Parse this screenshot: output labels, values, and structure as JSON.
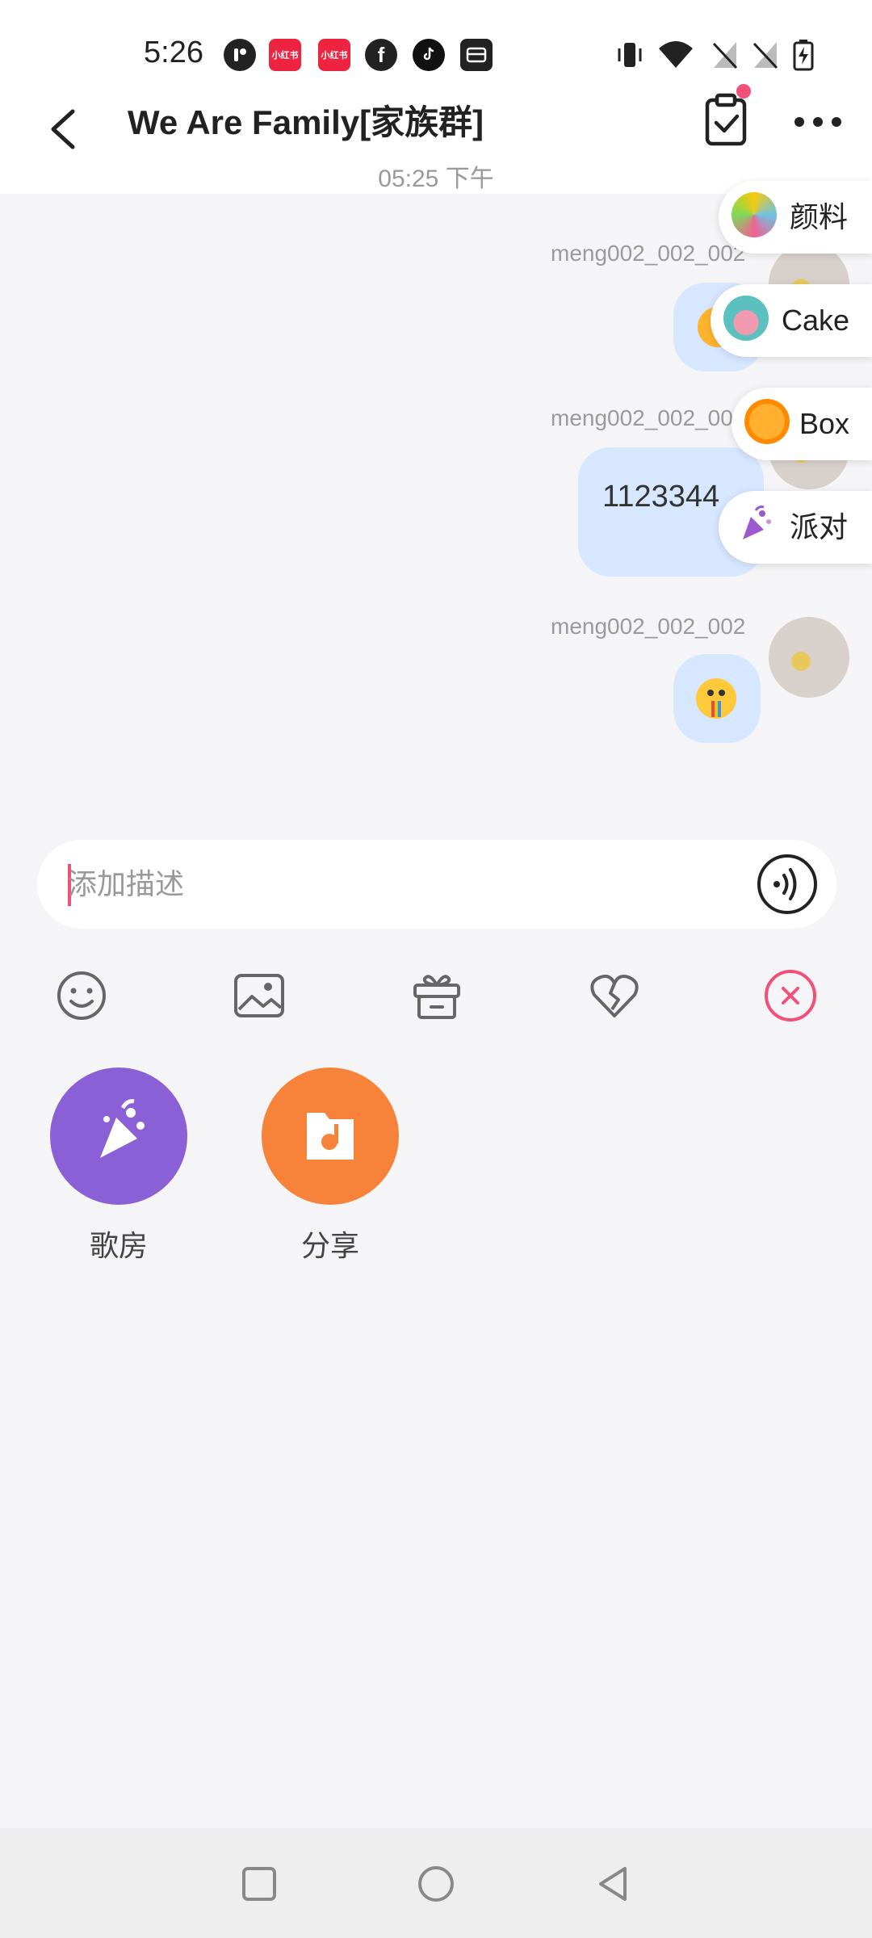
{
  "status_bar": {
    "time": "5:26",
    "app_icons": [
      "record-app-icon",
      "xiaohongshu-icon",
      "xiaohongshu-icon",
      "facebook-icon",
      "tiktok-icon",
      "inbox-app-icon"
    ],
    "xhs_label": "小红书",
    "right_icons": [
      "vibrate-icon",
      "wifi-icon",
      "no-sim-icon",
      "no-sim-icon",
      "battery-charging-icon"
    ]
  },
  "header": {
    "title": "We Are Family[家族群]",
    "back_icon": "chevron-left-icon",
    "task_icon": "clipboard-check-icon",
    "more_icon": "more-horizontal-icon"
  },
  "chat": {
    "timestamp": "05:25 下午",
    "messages": [
      {
        "sender": "meng002_002_002",
        "content_type": "emoji",
        "emoji_name": "smiling-face-emoji"
      },
      {
        "sender": "meng002_002_002",
        "content_type": "text",
        "text": "1123344"
      },
      {
        "sender": "meng002_002_002",
        "content_type": "emoji",
        "emoji_name": "rainbow-vomit-emoji"
      }
    ]
  },
  "floating_effects": [
    {
      "label": "颜料",
      "icon": "paint-splash-icon"
    },
    {
      "label": "Cake",
      "icon": "cake-icon"
    },
    {
      "label": "Box",
      "icon": "gift-box-icon"
    },
    {
      "label": "派对",
      "icon": "party-popper-icon"
    }
  ],
  "input": {
    "placeholder": "添加描述",
    "value": "",
    "voice_icon": "voice-wave-icon"
  },
  "toolbar": {
    "icons": [
      "emoji-face-icon",
      "image-icon",
      "gift-icon",
      "broken-heart-icon",
      "close-circle-icon"
    ]
  },
  "actions": [
    {
      "label": "歌房",
      "icon": "karaoke-icon",
      "color": "#8b60d6"
    },
    {
      "label": "分享",
      "icon": "folder-music-icon",
      "color": "#f7823a"
    }
  ],
  "colors": {
    "accent": "#f25079",
    "bubble": "#d7e7ff",
    "background": "#f5f5f7"
  },
  "navigation": {
    "buttons": [
      "recents-square-icon",
      "home-circle-icon",
      "back-triangle-icon"
    ]
  }
}
